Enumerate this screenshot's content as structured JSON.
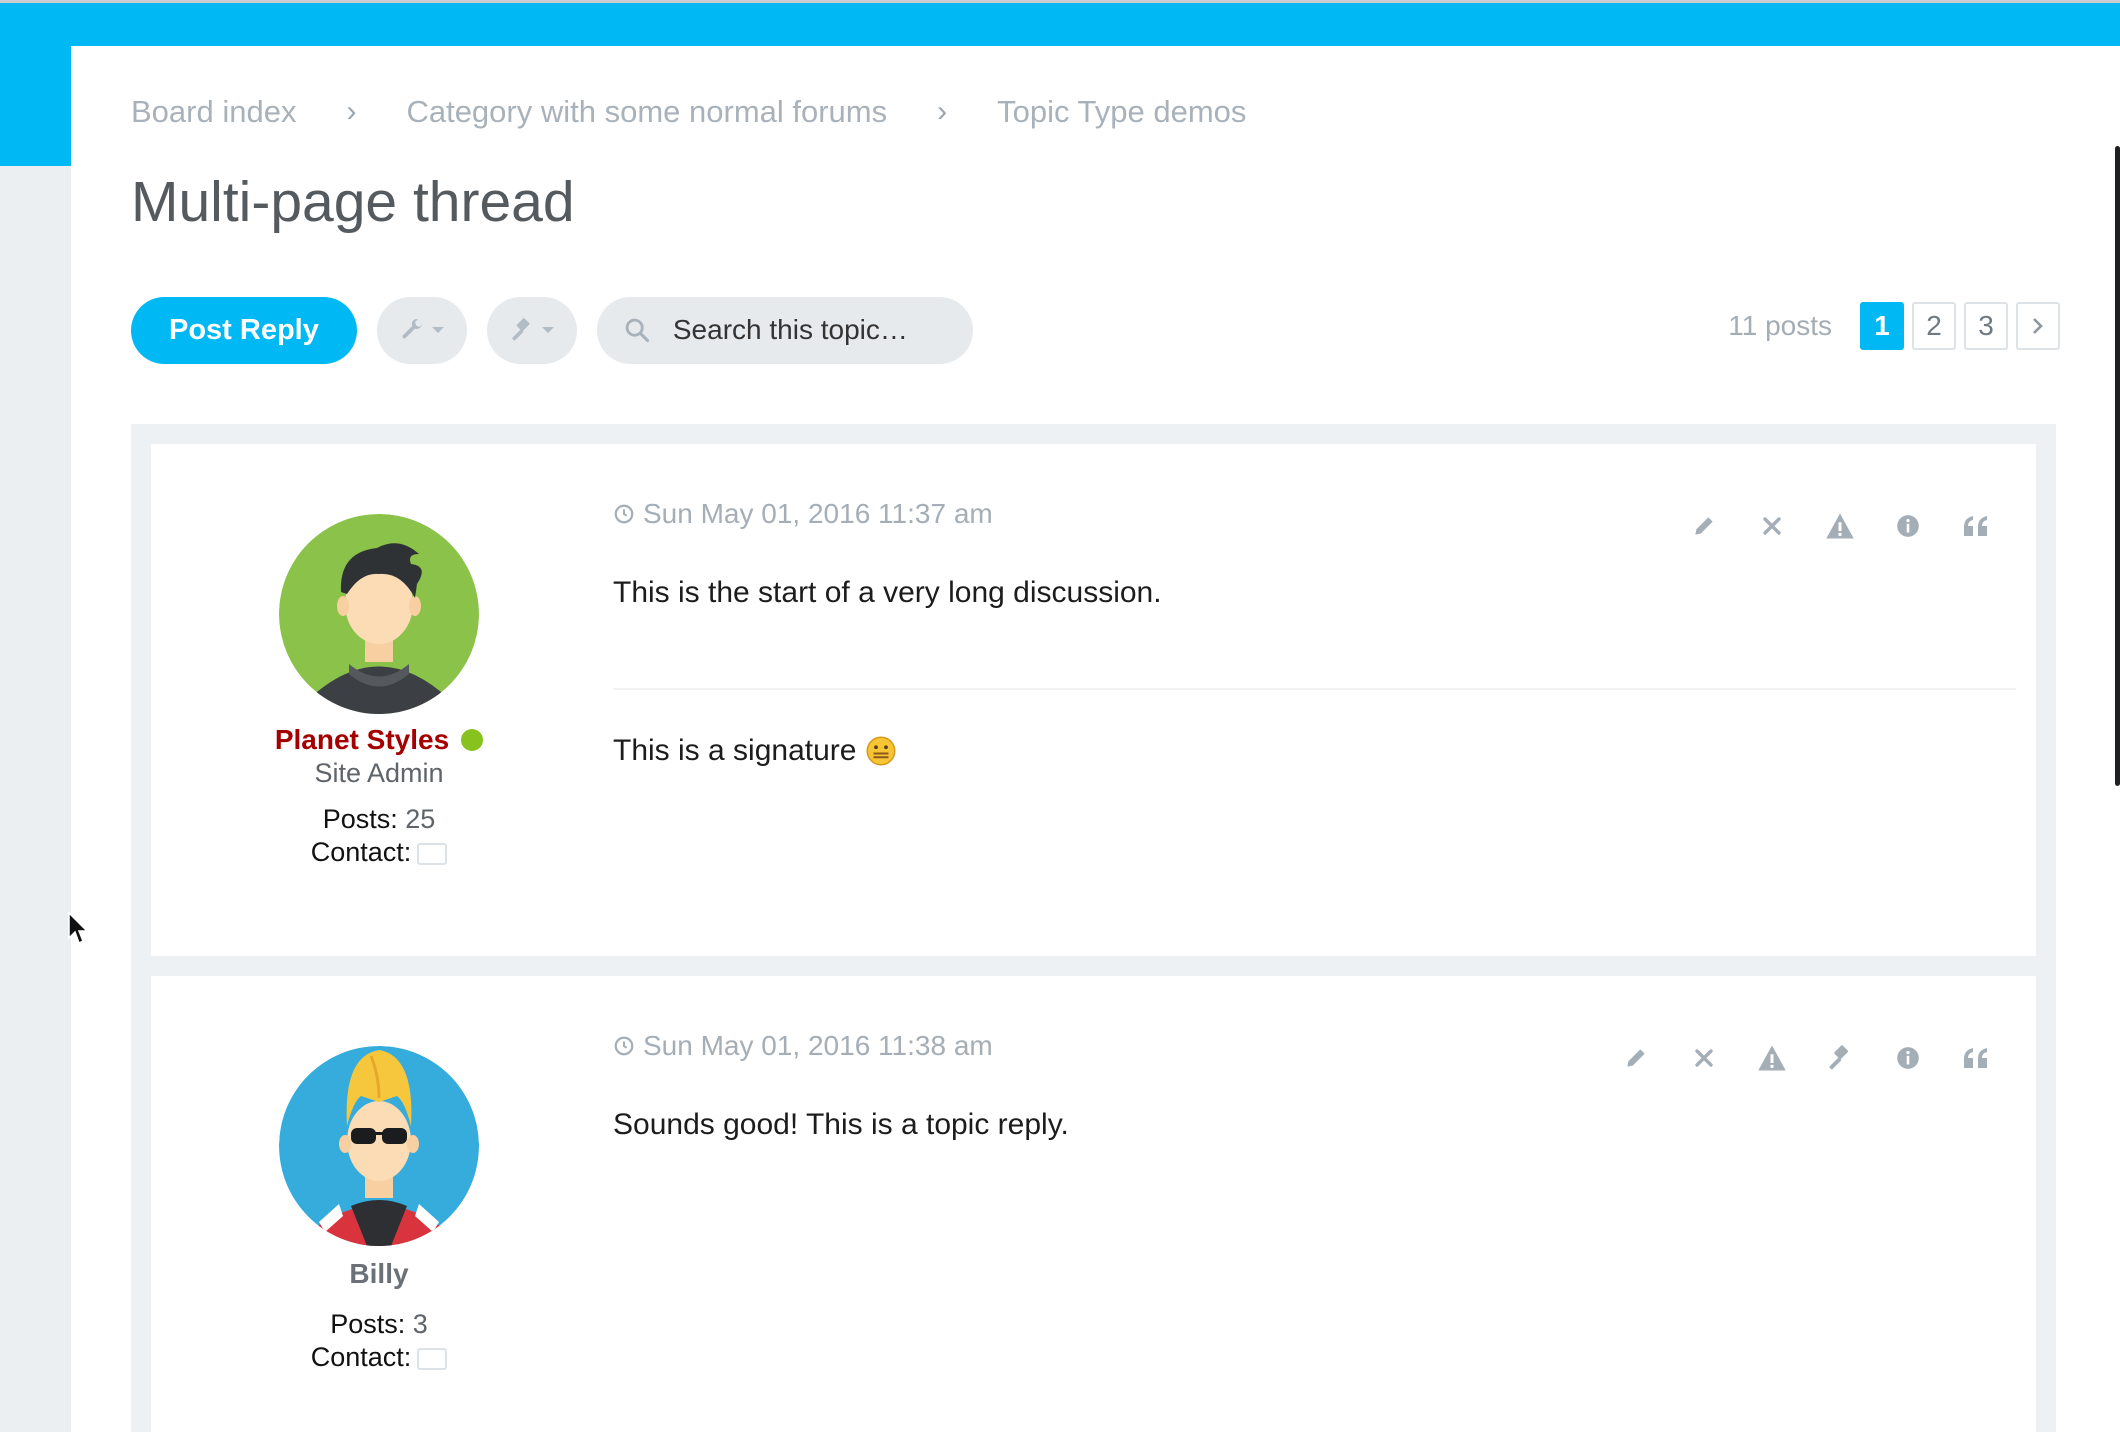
{
  "breadcrumb": {
    "items": [
      "Board index",
      "Category with some normal forums",
      "Topic Type demos"
    ],
    "separator": "›"
  },
  "topic": {
    "title": "Multi-page thread"
  },
  "toolbar": {
    "post_reply_label": "Post Reply",
    "search_placeholder": "Search this topic…",
    "topic_tools_icon": "wrench-icon",
    "mod_tools_icon": "gavel-icon"
  },
  "pagination": {
    "post_count": "11 posts",
    "pages": [
      "1",
      "2",
      "3"
    ],
    "current": "1",
    "next_icon": "chevron-right-icon"
  },
  "colors": {
    "brand": "#00b8f4",
    "admin_name": "#a50000",
    "online": "#87c21f",
    "muted": "#a5aeb6"
  },
  "posts": [
    {
      "author": "Planet Styles",
      "rank": "Site Admin",
      "online": true,
      "posts_label": "Posts:",
      "posts_count": "25",
      "contact_label": "Contact:",
      "date": "Sun May 01, 2016 11:37 am",
      "body": "This is the start of a very long discussion.",
      "signature": "This is a signature",
      "actions": [
        "edit-icon",
        "delete-icon",
        "report-icon",
        "info-icon",
        "quote-icon"
      ]
    },
    {
      "author": "Billy",
      "posts_label": "Posts:",
      "posts_count": "3",
      "contact_label": "Contact:",
      "date": "Sun May 01, 2016 11:38 am",
      "body": "Sounds good! This is a topic reply.",
      "actions": [
        "edit-icon",
        "delete-icon",
        "report-icon",
        "moderate-icon",
        "info-icon",
        "quote-icon"
      ]
    }
  ]
}
